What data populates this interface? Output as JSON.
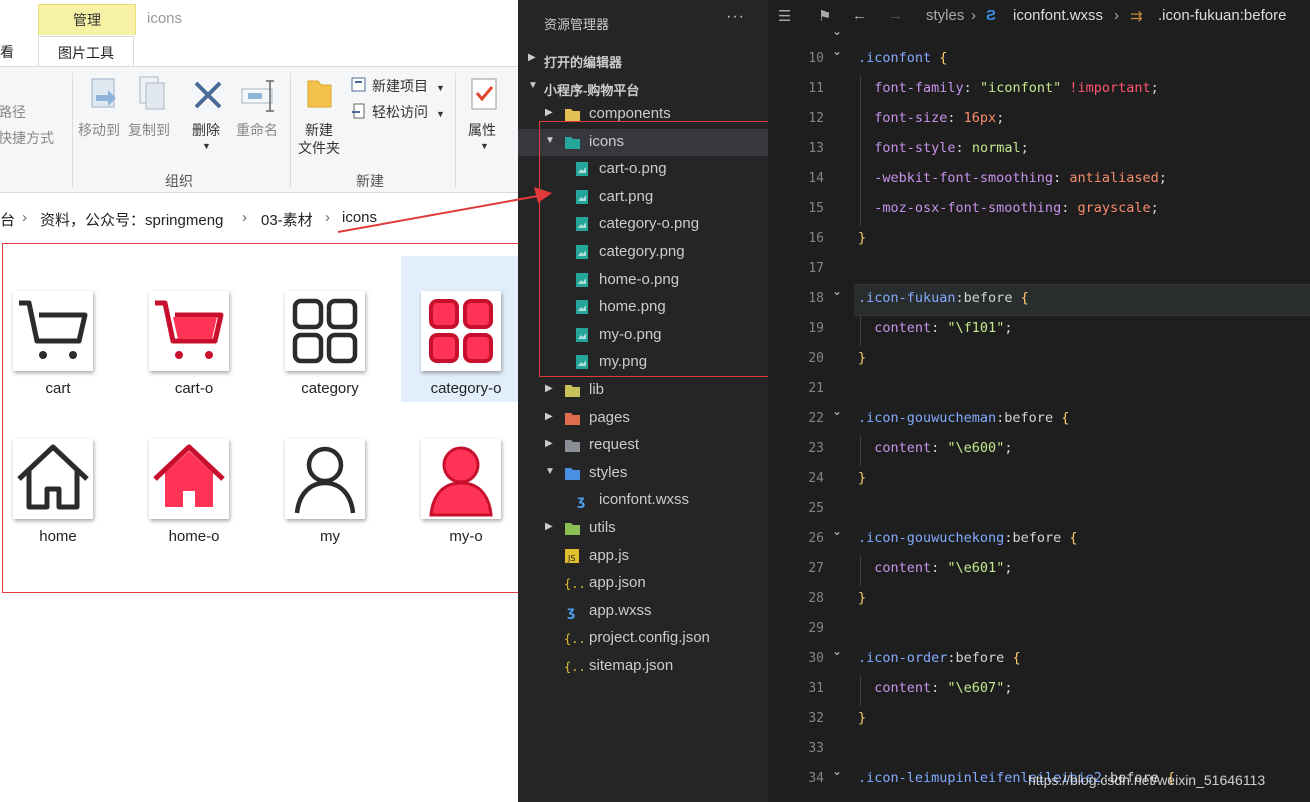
{
  "explorer": {
    "context_tab": "管理",
    "window_title": "icons",
    "tabs": [
      "查看",
      "图片工具"
    ],
    "ribbon": {
      "left_partial": [
        "路径",
        "快捷方式"
      ],
      "move_to": "移动到",
      "copy_to": "复制到",
      "delete": "删除",
      "rename": "重命名",
      "group_organize": "组织",
      "new_folder": "新建\n文件夹",
      "new_item": "新建项目",
      "easy_access": "轻松访问",
      "group_new": "新建",
      "properties": "属性"
    },
    "breadcrumb": [
      "台",
      "资料，公众号：springmeng",
      "03-素材",
      "icons"
    ],
    "items": [
      {
        "label": "cart",
        "icon": "cart-outline",
        "selected": false
      },
      {
        "label": "cart-o",
        "icon": "cart-filled",
        "selected": false
      },
      {
        "label": "category",
        "icon": "category-outline",
        "selected": false
      },
      {
        "label": "category-o",
        "icon": "category-filled",
        "selected": true
      },
      {
        "label": "home",
        "icon": "home-outline",
        "selected": false
      },
      {
        "label": "home-o",
        "icon": "home-filled",
        "selected": false
      },
      {
        "label": "my",
        "icon": "user-outline",
        "selected": false
      },
      {
        "label": "my-o",
        "icon": "user-filled",
        "selected": false
      }
    ],
    "accent_red": "#e8243e",
    "outline_color": "#333333"
  },
  "sidebar": {
    "title": "资源管理器",
    "more": "···",
    "sections": [
      "打开的编辑器",
      "小程序-购物平台"
    ],
    "tree": [
      {
        "label": "components",
        "depth": 1,
        "kind": "folder",
        "open": false
      },
      {
        "label": "icons",
        "depth": 1,
        "kind": "folder",
        "open": true
      },
      {
        "label": "cart-o.png",
        "depth": 2,
        "kind": "image"
      },
      {
        "label": "cart.png",
        "depth": 2,
        "kind": "image"
      },
      {
        "label": "category-o.png",
        "depth": 2,
        "kind": "image"
      },
      {
        "label": "category.png",
        "depth": 2,
        "kind": "image"
      },
      {
        "label": "home-o.png",
        "depth": 2,
        "kind": "image"
      },
      {
        "label": "home.png",
        "depth": 2,
        "kind": "image"
      },
      {
        "label": "my-o.png",
        "depth": 2,
        "kind": "image"
      },
      {
        "label": "my.png",
        "depth": 2,
        "kind": "image"
      },
      {
        "label": "lib",
        "depth": 1,
        "kind": "folder",
        "open": false
      },
      {
        "label": "pages",
        "depth": 1,
        "kind": "folder",
        "open": false
      },
      {
        "label": "request",
        "depth": 1,
        "kind": "folder",
        "open": false
      },
      {
        "label": "styles",
        "depth": 1,
        "kind": "folder",
        "open": true
      },
      {
        "label": "iconfont.wxss",
        "depth": 2,
        "kind": "css"
      },
      {
        "label": "utils",
        "depth": 1,
        "kind": "folder",
        "open": false
      },
      {
        "label": "app.js",
        "depth": 1,
        "kind": "js"
      },
      {
        "label": "app.json",
        "depth": 1,
        "kind": "json"
      },
      {
        "label": "app.wxss",
        "depth": 1,
        "kind": "css"
      },
      {
        "label": "project.config.json",
        "depth": 1,
        "kind": "json"
      },
      {
        "label": "sitemap.json",
        "depth": 1,
        "kind": "json"
      }
    ]
  },
  "editor": {
    "breadcrumb": [
      "styles",
      "iconfont.wxss",
      ".icon-fukuan:before"
    ],
    "lines": [
      {
        "n": "10",
        "fold": true,
        "segs": [
          [
            ".iconfont",
            "c-sel"
          ],
          [
            " ",
            ""
          ],
          [
            "{",
            "c-br"
          ]
        ]
      },
      {
        "n": "11",
        "segs": [
          [
            "  font-family",
            "c-prop"
          ],
          [
            ": ",
            "c-ps"
          ],
          [
            "\"iconfont\"",
            "c-str"
          ],
          [
            " ",
            ""
          ],
          [
            "!important",
            "c-imp"
          ],
          [
            ";",
            "c-ps"
          ]
        ]
      },
      {
        "n": "12",
        "segs": [
          [
            "  font-size",
            "c-prop"
          ],
          [
            ": ",
            "c-ps"
          ],
          [
            "16px",
            "c-num"
          ],
          [
            ";",
            "c-ps"
          ]
        ]
      },
      {
        "n": "13",
        "segs": [
          [
            "  font-style",
            "c-prop"
          ],
          [
            ": ",
            "c-ps"
          ],
          [
            "normal",
            "c-str"
          ],
          [
            ";",
            "c-ps"
          ]
        ]
      },
      {
        "n": "14",
        "segs": [
          [
            "  -webkit-font-smoothing",
            "c-prop"
          ],
          [
            ": ",
            "c-ps"
          ],
          [
            "antialiased",
            "c-num"
          ],
          [
            ";",
            "c-ps"
          ]
        ]
      },
      {
        "n": "15",
        "segs": [
          [
            "  -moz-osx-font-smoothing",
            "c-prop"
          ],
          [
            ": ",
            "c-ps"
          ],
          [
            "grayscale",
            "c-num"
          ],
          [
            ";",
            "c-ps"
          ]
        ]
      },
      {
        "n": "16",
        "segs": [
          [
            "}",
            "c-br"
          ]
        ]
      },
      {
        "n": "17",
        "segs": []
      },
      {
        "n": "18",
        "fold": true,
        "segs": [
          [
            ".icon-fukuan",
            "c-sel"
          ],
          [
            ":before",
            "c-ps"
          ],
          [
            " ",
            ""
          ],
          [
            "{",
            "c-br"
          ]
        ]
      },
      {
        "n": "19",
        "segs": [
          [
            "  content",
            "c-prop"
          ],
          [
            ": ",
            "c-ps"
          ],
          [
            "\"\\f101\"",
            "c-str"
          ],
          [
            ";",
            "c-ps"
          ]
        ]
      },
      {
        "n": "20",
        "segs": [
          [
            "}",
            "c-br"
          ]
        ]
      },
      {
        "n": "21",
        "segs": []
      },
      {
        "n": "22",
        "fold": true,
        "segs": [
          [
            ".icon-gouwucheman",
            "c-sel"
          ],
          [
            ":before",
            "c-ps"
          ],
          [
            " ",
            ""
          ],
          [
            "{",
            "c-br"
          ]
        ]
      },
      {
        "n": "23",
        "segs": [
          [
            "  content",
            "c-prop"
          ],
          [
            ": ",
            "c-ps"
          ],
          [
            "\"\\e600\"",
            "c-str"
          ],
          [
            ";",
            "c-ps"
          ]
        ]
      },
      {
        "n": "24",
        "segs": [
          [
            "}",
            "c-br"
          ]
        ]
      },
      {
        "n": "25",
        "segs": []
      },
      {
        "n": "26",
        "fold": true,
        "segs": [
          [
            ".icon-gouwuchekong",
            "c-sel"
          ],
          [
            ":before",
            "c-ps"
          ],
          [
            " ",
            ""
          ],
          [
            "{",
            "c-br"
          ]
        ]
      },
      {
        "n": "27",
        "segs": [
          [
            "  content",
            "c-prop"
          ],
          [
            ": ",
            "c-ps"
          ],
          [
            "\"\\e601\"",
            "c-str"
          ],
          [
            ";",
            "c-ps"
          ]
        ]
      },
      {
        "n": "28",
        "segs": [
          [
            "}",
            "c-br"
          ]
        ]
      },
      {
        "n": "29",
        "segs": []
      },
      {
        "n": "30",
        "fold": true,
        "segs": [
          [
            ".icon-order",
            "c-sel"
          ],
          [
            ":before",
            "c-ps"
          ],
          [
            " ",
            ""
          ],
          [
            "{",
            "c-br"
          ]
        ]
      },
      {
        "n": "31",
        "segs": [
          [
            "  content",
            "c-prop"
          ],
          [
            ": ",
            "c-ps"
          ],
          [
            "\"\\e607\"",
            "c-str"
          ],
          [
            ";",
            "c-ps"
          ]
        ]
      },
      {
        "n": "32",
        "segs": [
          [
            "}",
            "c-br"
          ]
        ]
      },
      {
        "n": "33",
        "segs": []
      },
      {
        "n": "34",
        "fold": true,
        "segs": [
          [
            ".icon-leimupinleifenleileibie2",
            "c-sel"
          ],
          [
            ":before",
            "c-ps"
          ],
          [
            " ",
            ""
          ],
          [
            "{",
            "c-br"
          ]
        ]
      }
    ]
  },
  "watermark": "https://blog.csdn.net/weixin_51646113"
}
